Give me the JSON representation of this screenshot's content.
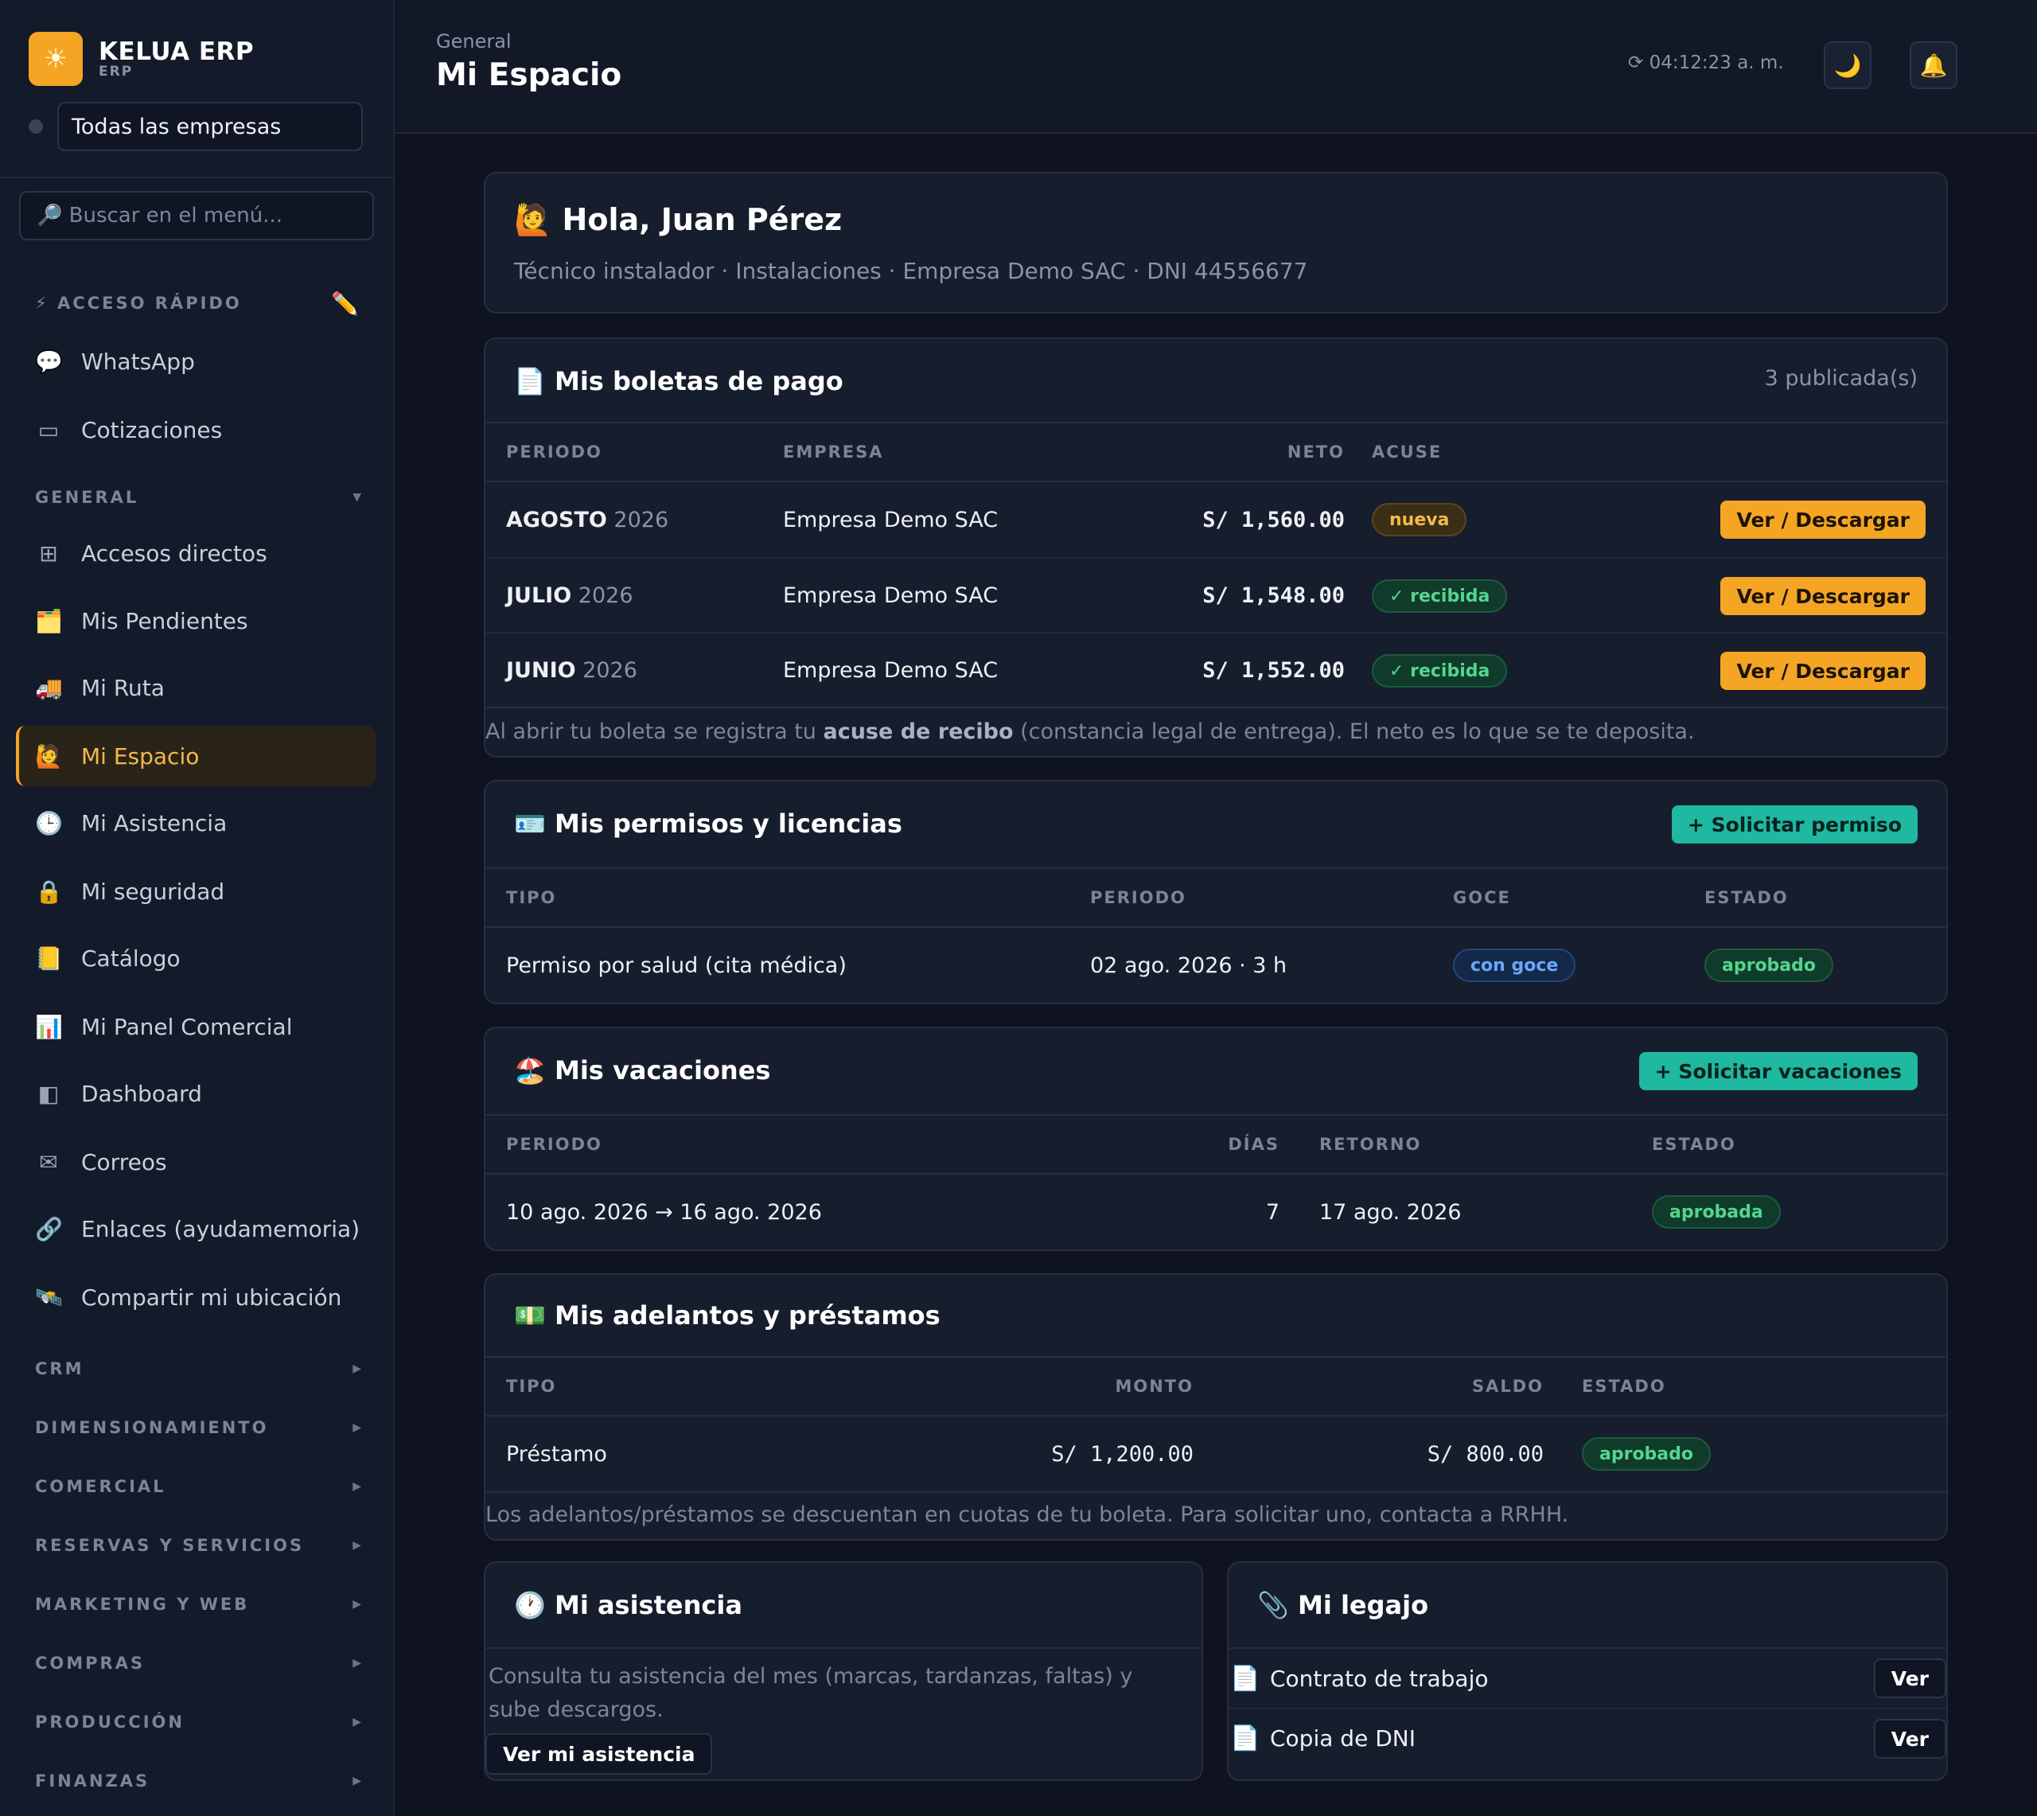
{
  "brand": {
    "logo_icon": "sun-icon",
    "name": "KELUA ERP",
    "sub": "ERP",
    "accent": "#f5a524"
  },
  "company_selector": {
    "value": "Todas las empresas"
  },
  "menu_search": {
    "placeholder": "🔎 Buscar en el menú..."
  },
  "sidebar": {
    "quick_access_title": "⚡ ACCESO RÁPIDO",
    "quick_items": [
      {
        "icon": "chat-bubble-icon",
        "glyph": "💬",
        "label": "WhatsApp"
      },
      {
        "icon": "quote-icon",
        "glyph": "▭",
        "label": "Cotizaciones"
      }
    ],
    "general_title": "GENERAL",
    "general_items": [
      {
        "icon": "grid-icon",
        "glyph": "⊞",
        "label": "Accesos directos"
      },
      {
        "icon": "folder-icon",
        "glyph": "🗂️",
        "label": "Mis Pendientes"
      },
      {
        "icon": "truck-icon",
        "glyph": "🚚",
        "label": "Mi Ruta"
      },
      {
        "icon": "person-raising-hand-icon",
        "glyph": "🙋",
        "label": "Mi Espacio",
        "active": true
      },
      {
        "icon": "clock-icon",
        "glyph": "🕒",
        "label": "Mi Asistencia"
      },
      {
        "icon": "lock-icon",
        "glyph": "🔒",
        "label": "Mi seguridad"
      },
      {
        "icon": "notebook-icon",
        "glyph": "📒",
        "label": "Catálogo"
      },
      {
        "icon": "bar-chart-icon",
        "glyph": "📊",
        "label": "Mi Panel Comercial"
      },
      {
        "icon": "dashboard-icon",
        "glyph": "◧",
        "label": "Dashboard"
      },
      {
        "icon": "envelope-icon",
        "glyph": "✉",
        "label": "Correos"
      },
      {
        "icon": "link-icon",
        "glyph": "🔗",
        "label": "Enlaces (ayudamemoria)"
      },
      {
        "icon": "satellite-icon",
        "glyph": "🛰️",
        "label": "Compartir mi ubicación"
      }
    ],
    "sections": [
      "CRM",
      "DIMENSIONAMIENTO",
      "COMERCIAL",
      "RESERVAS Y SERVICIOS",
      "MARKETING Y WEB",
      "COMPRAS",
      "PRODUCCIÓN",
      "FINANZAS"
    ]
  },
  "header": {
    "breadcrumb": "General",
    "title": "Mi Espacio",
    "clock": "⟳ 04:12:23 a. m.",
    "theme_icon": "moon-icon",
    "bell_icon": "bell-icon"
  },
  "greeting": {
    "title": "🙋 Hola, Juan Pérez",
    "subtitle": "Técnico instalador · Instalaciones · Empresa Demo SAC · DNI 44556677"
  },
  "payslips": {
    "title": "📄 Mis boletas de pago",
    "count": "3 publicada(s)",
    "columns": [
      "PERIODO",
      "EMPRESA",
      "NETO",
      "ACUSE"
    ],
    "rows": [
      {
        "month": "AGOSTO",
        "year": "2026",
        "company": "Empresa Demo SAC",
        "net": "S/ 1,560.00",
        "ack": "nueva",
        "action": "Ver / Descargar"
      },
      {
        "month": "JULIO",
        "year": "2026",
        "company": "Empresa Demo SAC",
        "net": "S/ 1,548.00",
        "ack": "✓ recibida",
        "action": "Ver / Descargar"
      },
      {
        "month": "JUNIO",
        "year": "2026",
        "company": "Empresa Demo SAC",
        "net": "S/ 1,552.00",
        "ack": "✓ recibida",
        "action": "Ver / Descargar"
      }
    ],
    "note_pre": "Al abrir tu boleta se registra tu ",
    "note_bold": "acuse de recibo",
    "note_post": " (constancia legal de entrega). El neto es lo que se te deposita."
  },
  "permits": {
    "title": "🪪 Mis permisos y licencias",
    "action": "+ Solicitar permiso",
    "columns": [
      "TIPO",
      "PERIODO",
      "GOCE",
      "ESTADO"
    ],
    "rows": [
      {
        "type": "Permiso por salud (cita médica)",
        "period": "02 ago. 2026 · 3 h",
        "pay": "con goce",
        "status": "aprobado"
      }
    ]
  },
  "vacations": {
    "title": "🏖️ Mis vacaciones",
    "action": "+ Solicitar vacaciones",
    "columns": [
      "PERIODO",
      "DÍAS",
      "RETORNO",
      "ESTADO"
    ],
    "rows": [
      {
        "period": "10 ago. 2026 → 16 ago. 2026",
        "days": "7",
        "return": "17 ago. 2026",
        "status": "aprobada"
      }
    ]
  },
  "loans": {
    "title": "💵 Mis adelantos y préstamos",
    "columns": [
      "TIPO",
      "MONTO",
      "SALDO",
      "ESTADO"
    ],
    "rows": [
      {
        "type": "Préstamo",
        "amount": "S/ 1,200.00",
        "balance": "S/ 800.00",
        "status": "aprobado"
      }
    ],
    "note": "Los adelantos/préstamos se descuentan en cuotas de tu boleta. Para solicitar uno, contacta a RRHH."
  },
  "attendance": {
    "title": "🕐 Mi asistencia",
    "text": "Consulta tu asistencia del mes (marcas, tardanzas, faltas) y sube descargos.",
    "action": "Ver mi asistencia"
  },
  "file": {
    "title": "📎 Mi legajo",
    "items": [
      {
        "icon": "document-icon",
        "label": "Contrato de trabajo",
        "action": "Ver"
      },
      {
        "icon": "document-icon",
        "label": "Copia de DNI",
        "action": "Ver"
      }
    ]
  }
}
